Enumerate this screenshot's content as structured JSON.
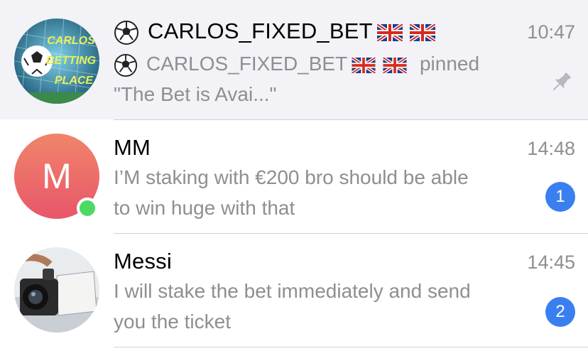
{
  "chats": [
    {
      "name": "CARLOS_FIXED_BET",
      "time": "10:47",
      "preview_sender": "CARLOS_FIXED_BET",
      "preview_action": "pinned",
      "preview_quote": "\"The Bet is Avai...\"",
      "avatar_text": [
        "CARLOS",
        "BETTING",
        "PLACE"
      ],
      "pinned": true,
      "icons": [
        "soccer-ball-icon",
        "uk-flag-icon",
        "uk-flag-icon",
        "pin-icon"
      ]
    },
    {
      "name": "MM",
      "time": "14:48",
      "avatar_initial": "M",
      "preview_line1": "I’M staking with €200 bro should be able",
      "preview_line2": "to win huge with that",
      "unread": "1",
      "online": true,
      "colors": {
        "avatar_top": "#f0856a",
        "avatar_bottom": "#e8566a",
        "online": "#4cd964"
      }
    },
    {
      "name": "Messi",
      "time": "14:45",
      "preview_line1": "I will stake the bet immediately and send",
      "preview_line2": "you the ticket",
      "unread": "2",
      "icons": [
        "camera-photo-avatar"
      ]
    }
  ],
  "colors": {
    "badge": "#3a7ff0",
    "secondary_text": "#8e8e93",
    "pinned_bg": "#f2f2f7"
  }
}
